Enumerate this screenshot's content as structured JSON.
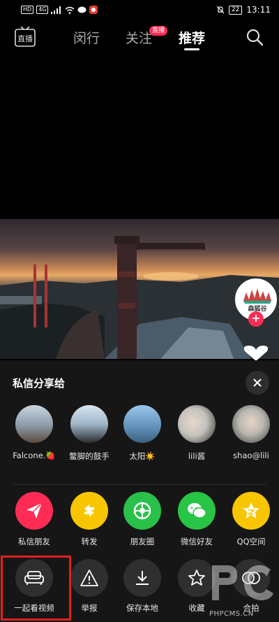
{
  "status_bar": {
    "left_chips": [
      "HD",
      "4G"
    ],
    "battery": "22",
    "time": "13:11"
  },
  "top_nav": {
    "live_icon_label": "直播",
    "tabs": [
      {
        "label": "闵行"
      },
      {
        "label": "关注"
      },
      {
        "label": "推荐"
      }
    ],
    "live_badge": "直播"
  },
  "creator_avatar": {
    "text": "森狐谷"
  },
  "share_sheet": {
    "title": "私信分享给",
    "contacts": [
      {
        "name": "Falcone.🍓",
        "color": "#8a9aa8"
      },
      {
        "name": "鳖脚的鼓手",
        "color": "#9fb6c8"
      },
      {
        "name": "太阳☀️",
        "color": "#5f8fb6"
      },
      {
        "name": "lili酱",
        "color": "#c4c2bc"
      },
      {
        "name": "shao@lili",
        "color": "#b9b6b0"
      }
    ],
    "apps": [
      {
        "label": "私信朋友",
        "color": "#fe2c55",
        "icon": "send-icon"
      },
      {
        "label": "转发",
        "color": "#f7c600",
        "icon": "repost-icon"
      },
      {
        "label": "朋友圈",
        "color": "#2ac14a",
        "icon": "moments-icon"
      },
      {
        "label": "微信好友",
        "color": "#28c445",
        "icon": "wechat-icon"
      },
      {
        "label": "QQ空间",
        "color": "#f7c600",
        "icon": "qzone-icon"
      }
    ],
    "actions": [
      {
        "label": "一起看视频",
        "icon": "sofa-icon"
      },
      {
        "label": "举报",
        "icon": "warning-icon"
      },
      {
        "label": "保存本地",
        "icon": "download-icon"
      },
      {
        "label": "收藏",
        "icon": "star-icon"
      },
      {
        "label": "合拍",
        "icon": "duet-icon"
      }
    ]
  },
  "watermark": {
    "text": "PHPCMS.CN"
  }
}
